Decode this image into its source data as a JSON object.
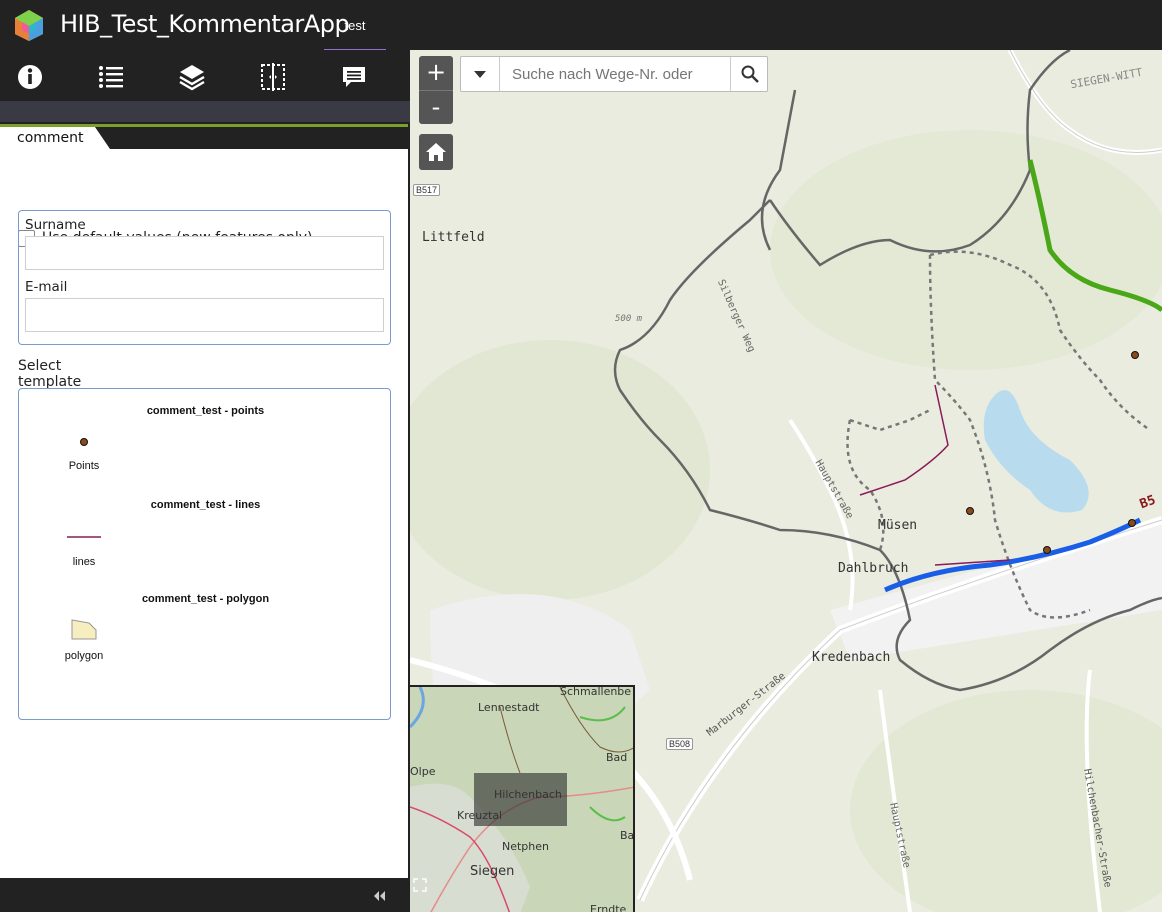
{
  "header": {
    "app_title": "HIB_Test_KommentarApp",
    "tab_label": "test"
  },
  "toolbar": {
    "icons": [
      "info-icon",
      "legend-list-icon",
      "layers-icon",
      "swipe-icon",
      "comment-icon"
    ]
  },
  "panel": {
    "tab_label": "comment",
    "default_values_label": "Use default values (new features only)",
    "fields": [
      {
        "label": "Surname",
        "value": ""
      },
      {
        "label": "E-mail",
        "value": ""
      }
    ],
    "select_template_label": "Select template",
    "templates": [
      {
        "title": "comment_test - points",
        "caption": "Points"
      },
      {
        "title": "comment_test - lines",
        "caption": "lines"
      },
      {
        "title": "comment_test - polygon",
        "caption": "polygon"
      }
    ]
  },
  "map": {
    "zoom_in": "+",
    "zoom_out": "-",
    "search_placeholder": "Suche nach Wege-Nr. oder",
    "labels": {
      "littfeld": "Littfeld",
      "musen": "Müsen",
      "dahlbruch": "Dahlbruch",
      "kredenbach": "Kredenbach",
      "siegen_witt": "SIEGEN-WITT",
      "silberger": "Silberger Weg",
      "hauptstrasse1": "Hauptstraße",
      "hauptstrasse2": "Hauptstraße",
      "marburger": "Marburger-Straße",
      "hilchenbacher": "Hilchenbacher-Straße",
      "elevation": "500 m",
      "b517": "B517",
      "b508": "B508",
      "b5_edge": "B5"
    },
    "overview": {
      "lennestadt": "Lennestadt",
      "schmallenberg": "Schmallenbe",
      "olpe": "Olpe",
      "hilchenbach": "Hilchenbach",
      "kreuztal": "Kreuztal",
      "netphen": "Netphen",
      "siegen": "Siegen",
      "bad": "Bad",
      "ba": "Ba",
      "erndte": "Erndte"
    }
  },
  "colors": {
    "header_bg": "#222222",
    "accent_green": "#7aa02e",
    "tab_underline": "#8f6fd0",
    "trail_green": "#4aa818",
    "trail_blue": "#1a5ee8",
    "boundary_gray": "#666666",
    "comment_line": "#8a1a5a"
  }
}
